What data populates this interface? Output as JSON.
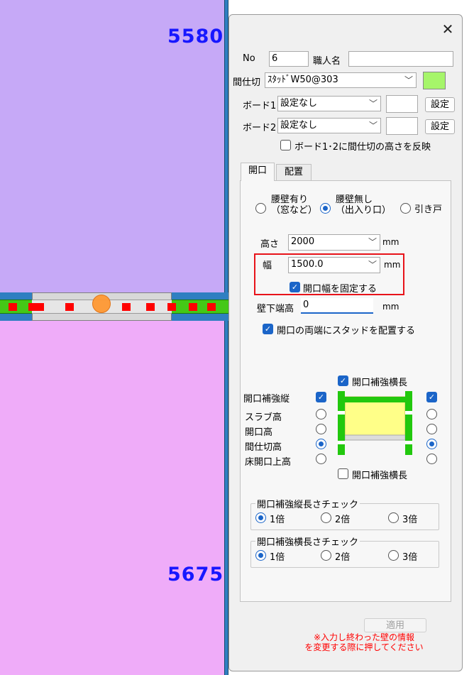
{
  "canvas": {
    "room_top": "5580",
    "room_bottom": "5675",
    "colors": {
      "room_top": "#c6a9f7",
      "room_bottom": "#efacf9",
      "wall_green": "#44c817",
      "wall_blue": "#2f7fc1",
      "marker": "#ff0000",
      "node": "#ff9933"
    }
  },
  "dialog": {
    "close_label": "✕",
    "no_label": "No",
    "no_value": "6",
    "worker_label": "職人名",
    "worker_value": "",
    "partition_label": "間仕切",
    "partition_value": "ｽﾀｯﾄﾞW50@303",
    "partition_color": "#a6f56a",
    "board1_label": "ボード1",
    "board1_value": "設定なし",
    "board2_label": "ボード2",
    "board2_value": "設定なし",
    "set_label": "設定",
    "reflect_height_label": "ボード1･2に間仕切の高さを反映",
    "tabs": [
      "開口",
      "配置"
    ],
    "opening_types": {
      "waist_wall_1": "腰壁有り",
      "waist_wall_2": "（窓など）",
      "no_waist_1": "腰壁無し",
      "no_waist_2": "（出入り口）",
      "sliding": "引き戸"
    },
    "height_label": "高さ",
    "height_value": "2000",
    "width_label": "幅",
    "width_value": "1500.0",
    "unit": "mm",
    "fix_width_label": "開口幅を固定する",
    "bottom_height_label": "壁下端高",
    "bottom_height_value": "0",
    "stud_both_ends_label": "開口の両端にスタッドを配置する",
    "reinforce_horizontal_top": "開口補強横長",
    "reinforce_vertical": "開口補強縦",
    "reinforce_horizontal_bottom": "開口補強横長",
    "height_options": [
      "スラブ高",
      "開口高",
      "間仕切高",
      "床開口上高"
    ],
    "vertical_check_group": "開口補強縦長さチェック",
    "horizontal_check_group": "開口補強横長さチェック",
    "multipliers": [
      "1倍",
      "2倍",
      "3倍"
    ],
    "apply_label": "適用",
    "note_line1": "※入力し終わった壁の情報",
    "note_line2": "を変更する際に押してください"
  }
}
